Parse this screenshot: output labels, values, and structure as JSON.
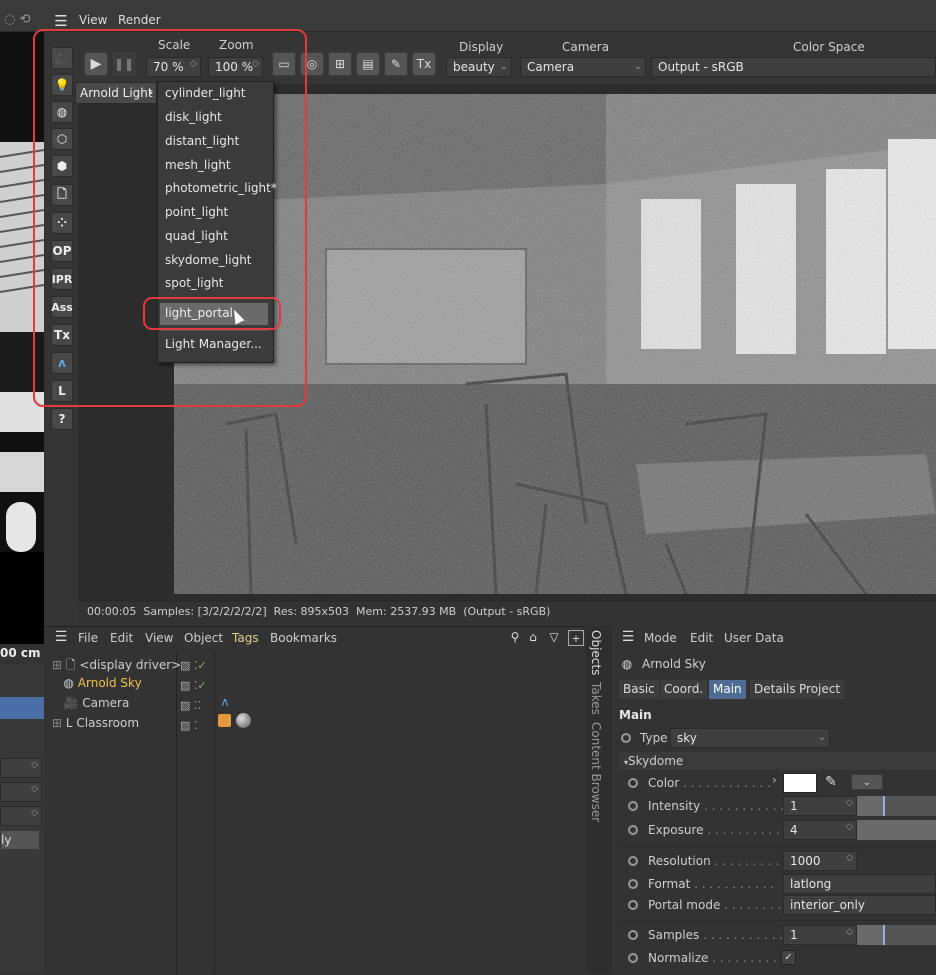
{
  "top_menu": {
    "view": "View",
    "render": "Render"
  },
  "controls": {
    "scale_label": "Scale",
    "scale_value": "70 %",
    "zoom_label": "Zoom",
    "zoom_value": "100 %",
    "display_label": "Display",
    "display_value": "beauty",
    "camera_label": "Camera",
    "camera_value": "Camera",
    "colorspace_label": "Color Space",
    "colorspace_value": "Output - sRGB",
    "tx_label": "Tx"
  },
  "toolbar": {
    "op": "OP",
    "ipr": "IPR",
    "ass": "Ass",
    "tx": "Tx",
    "l": "L",
    "help": "?"
  },
  "submenu_trigger": "Arnold Light",
  "light_menu": [
    "cylinder_light",
    "disk_light",
    "distant_light",
    "mesh_light",
    "photometric_light*",
    "point_light",
    "quad_light",
    "skydome_light",
    "spot_light"
  ],
  "light_menu_highlight": "light_portal",
  "light_menu_manager": "Light Manager...",
  "status_bar": "00:00:05  Samples: [3/2/2/2/2/2]  Res: 895x503  Mem: 2537.93 MB  (Output - sRGB)",
  "left_panel": {
    "measure": "00 cm",
    "only": "ly"
  },
  "object_manager": {
    "menu": [
      "File",
      "Edit",
      "View",
      "Object",
      "Tags",
      "Bookmarks"
    ],
    "objects": [
      "<display driver>",
      "Arnold Sky",
      "Camera",
      "Classroom"
    ],
    "side_tabs": [
      "Objects",
      "Takes",
      "Content Browser"
    ]
  },
  "attributes": {
    "menu": [
      "Mode",
      "Edit",
      "User Data"
    ],
    "object_name": "Arnold Sky",
    "tabs": [
      "Basic",
      "Coord.",
      "Main",
      "Details",
      "Project"
    ],
    "active_tab": "Main",
    "section": "Main",
    "type_label": "Type",
    "type_value": "sky",
    "group": "Skydome",
    "color_label": "Color",
    "intensity_label": "Intensity",
    "intensity_value": "1",
    "exposure_label": "Exposure",
    "exposure_value": "4",
    "resolution_label": "Resolution",
    "resolution_value": "1000",
    "format_label": "Format",
    "format_value": "latlong",
    "portal_label": "Portal mode",
    "portal_value": "interior_only",
    "samples_label": "Samples",
    "samples_value": "1",
    "normalize_label": "Normalize"
  }
}
